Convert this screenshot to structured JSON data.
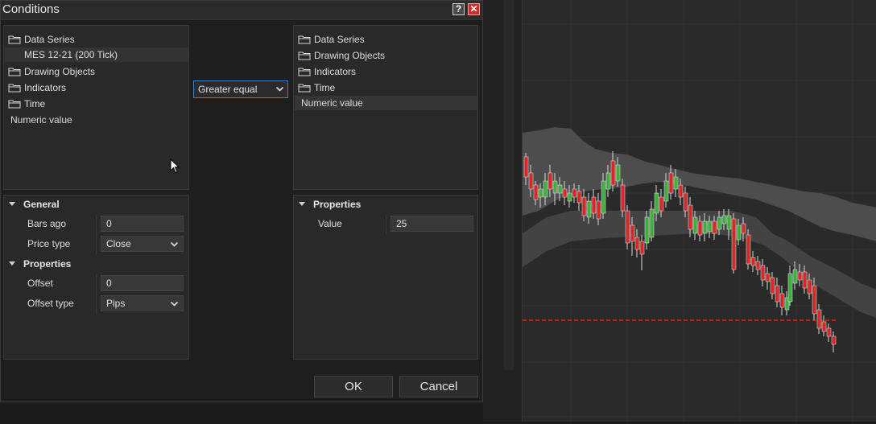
{
  "dialog": {
    "title": "Conditions",
    "help_label": "?",
    "close_label": "✕"
  },
  "left_tree": {
    "items": [
      {
        "label": "Data Series",
        "icon": "folder-icon"
      },
      {
        "label": "MES 12-21 (200 Tick)"
      },
      {
        "label": "Drawing Objects",
        "icon": "folder-icon"
      },
      {
        "label": "Indicators",
        "icon": "folder-icon"
      },
      {
        "label": "Time",
        "icon": "folder-icon"
      },
      {
        "label": "Numeric value"
      }
    ]
  },
  "operator": {
    "selected": "Greater equal"
  },
  "right_tree": {
    "items": [
      {
        "label": "Data Series",
        "icon": "folder-icon"
      },
      {
        "label": "Drawing Objects",
        "icon": "folder-icon"
      },
      {
        "label": "Indicators",
        "icon": "folder-icon"
      },
      {
        "label": "Time",
        "icon": "folder-icon"
      },
      {
        "label": "Numeric value"
      }
    ]
  },
  "left_props": {
    "general": {
      "title": "General",
      "bars_ago_label": "Bars ago",
      "bars_ago_value": "0",
      "price_type_label": "Price type",
      "price_type_value": "Close"
    },
    "properties": {
      "title": "Properties",
      "offset_label": "Offset",
      "offset_value": "0",
      "offset_type_label": "Offset type",
      "offset_type_value": "Pips"
    }
  },
  "right_props": {
    "title": "Properties",
    "value_label": "Value",
    "value_value": "25"
  },
  "buttons": {
    "ok": "OK",
    "cancel": "Cancel"
  },
  "colors": {
    "up_candle": "#3fae3f",
    "down_candle": "#d9262a",
    "dash_line": "#e0201a",
    "band": "#6b6b6b"
  }
}
